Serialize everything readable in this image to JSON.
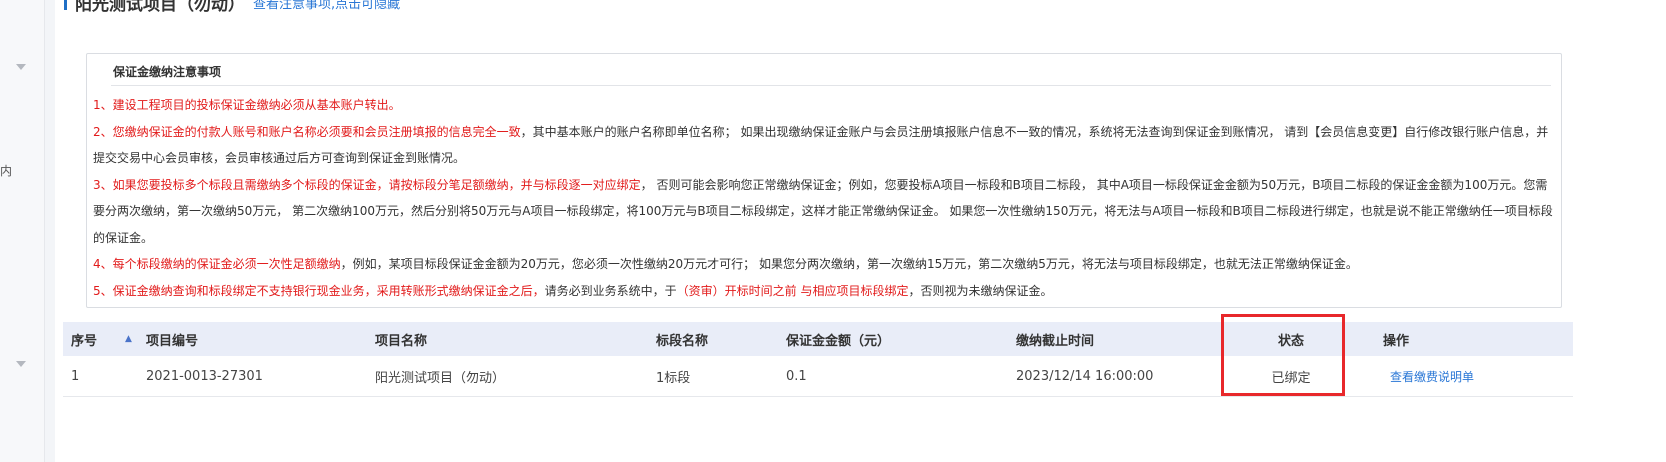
{
  "left_rail": {
    "partial_text": "内"
  },
  "header": {
    "title": "阳光测试项目（勿动）",
    "toggle_link": "查看注意事项,点击可隐藏"
  },
  "notice": {
    "title": "保证金缴纳注意事项",
    "items": [
      {
        "red": "1、建设工程项目的投标保证金缴纳必须从基本账户转出。",
        "normal": ""
      },
      {
        "red": "2、您缴纳保证金的付款人账号和账户名称必须要和会员注册填报的信息完全一致",
        "normal": "，其中基本账户的账户名称即单位名称； 如果出现缴纳保证金账户与会员注册填报账户信息不一致的情况，系统将无法查询到保证金到账情况， 请到【会员信息变更】自行修改银行账户信息，并提交交易中心会员审核，会员审核通过后方可查询到保证金到账情况。"
      },
      {
        "red": "3、如果您要投标多个标段且需缴纳多个标段的保证金，请按标段分笔足额缴纳，并与标段逐一对应绑定",
        "normal": "， 否则可能会影响您正常缴纳保证金；例如，您要投标A项目一标段和B项目二标段， 其中A项目一标段保证金金额为50万元，B项目二标段的保证金金额为100万元。您需要分两次缴纳，第一次缴纳50万元， 第二次缴纳100万元，然后分别将50万元与A项目一标段绑定，将100万元与B项目二标段绑定，这样才能正常缴纳保证金。 如果您一次性缴纳150万元，将无法与A项目一标段和B项目二标段进行绑定，也就是说不能正常缴纳任一项目标段的保证金。"
      },
      {
        "red": "4、每个标段缴纳的保证金必须一次性足额缴纳",
        "normal": "，例如，某项目标段保证金金额为20万元，您必须一次性缴纳20万元才可行； 如果您分两次缴纳，第一次缴纳15万元，第二次缴纳5万元，将无法与项目标段绑定，也就无法正常缴纳保证金。"
      },
      {
        "red": "5、保证金缴纳查询和标段绑定不支持银行现金业务，采用转账形式缴纳保证金之后，",
        "normal": "请务必到业务系统中，于",
        "red2": "（资审）开标时间之前 与相应项目标段绑定",
        "normal2": "，否则视为未缴纳保证金。"
      }
    ]
  },
  "table": {
    "headers": {
      "seq": "序号",
      "project_no": "项目编号",
      "project_name": "项目名称",
      "section_name": "标段名称",
      "amount": "保证金金额（元）",
      "deadline": "缴纳截止时间",
      "status": "状态",
      "action": "操作"
    },
    "rows": [
      {
        "seq": "1",
        "project_no": "2021-0013-27301",
        "project_name": "阳光测试项目（勿动）",
        "section_name": "1标段",
        "amount": "0.1",
        "deadline": "2023/12/14 16:00:00",
        "status": "已绑定",
        "action": "查看缴费说明单"
      }
    ]
  },
  "colors": {
    "accent": "#1f6fc6",
    "link": "#2a77d6",
    "warning_red": "#e21b1b",
    "highlight_red": "#e8282b",
    "table_header_bg": "#e9edf8"
  },
  "icons": {
    "rail_chevron": "chevron-down-icon",
    "sort": "sort-up-icon"
  }
}
